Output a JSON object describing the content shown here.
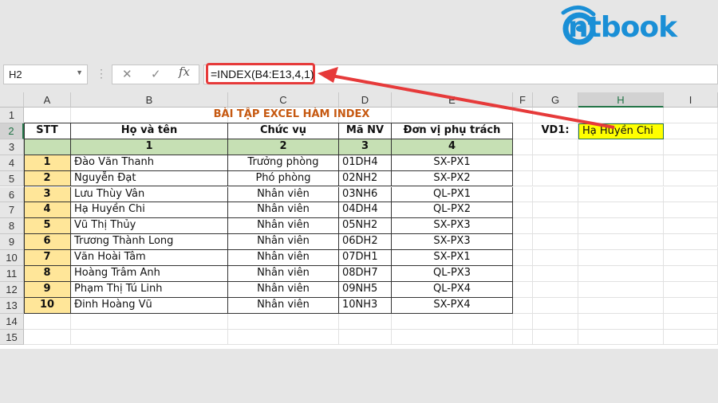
{
  "logo": {
    "text": "ntbook"
  },
  "formula_bar": {
    "name_box": "H2",
    "formula": "=INDEX(B4:E13,4,1)",
    "fx_label": "fx"
  },
  "columns": [
    "A",
    "B",
    "C",
    "D",
    "E",
    "F",
    "G",
    "H",
    "I"
  ],
  "rows": [
    "1",
    "2",
    "3",
    "4",
    "5",
    "6",
    "7",
    "8",
    "9",
    "10",
    "11",
    "12",
    "13",
    "14",
    "15"
  ],
  "sheet": {
    "title": "BÀI TẬP EXCEL HÀM INDEX",
    "headers": [
      "STT",
      "Họ và tên",
      "Chức vụ",
      "Mã NV",
      "Đơn vị phụ trách"
    ],
    "index_row": [
      "1",
      "2",
      "3",
      "4"
    ],
    "data": [
      [
        "1",
        "Đào Văn Thanh",
        "Trưởng phòng",
        "01DH4",
        "SX-PX1"
      ],
      [
        "2",
        "Nguyễn Đạt",
        "Phó phòng",
        "02NH2",
        "SX-PX2"
      ],
      [
        "3",
        "Lưu Thùy Vân",
        "Nhân viên",
        "03NH6",
        "QL-PX1"
      ],
      [
        "4",
        "Hạ Huyền Chi",
        "Nhân viên",
        "04DH4",
        "QL-PX2"
      ],
      [
        "5",
        "Vũ Thị Thủy",
        "Nhân viên",
        "05NH2",
        "SX-PX3"
      ],
      [
        "6",
        "Trương Thành Long",
        "Nhân viên",
        "06DH2",
        "SX-PX3"
      ],
      [
        "7",
        "Văn Hoài Tâm",
        "Nhân viên",
        "07DH1",
        "SX-PX1"
      ],
      [
        "8",
        "Hoàng Trâm Anh",
        "Nhân viên",
        "08DH7",
        "QL-PX3"
      ],
      [
        "9",
        "Phạm Thị Tú Linh",
        "Nhân viên",
        "09NH5",
        "QL-PX4"
      ],
      [
        "10",
        "Đinh Hoàng Vũ",
        "Nhân viên",
        "10NH3",
        "SX-PX4"
      ]
    ],
    "vd1_label": "VD1:",
    "vd1_result": "Hạ Huyền Chi"
  },
  "colors": {
    "arrow": "#e63a3a",
    "header_green": "#c6e0b4",
    "stt_yellow": "#ffe699",
    "result_yellow": "#ffff00",
    "title_orange": "#c65911",
    "logo_blue": "#1a8fd6"
  }
}
